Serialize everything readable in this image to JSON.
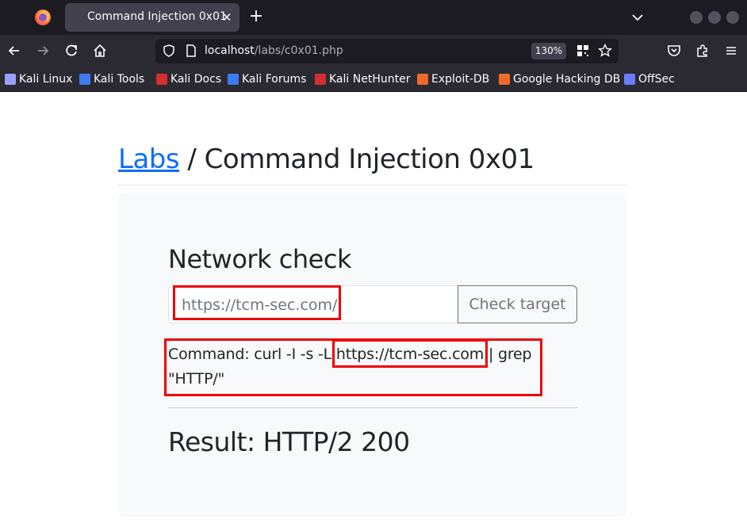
{
  "browser": {
    "tab_title": "Command Injection 0x01",
    "tab_close": "✕",
    "new_tab": "+",
    "url_host": "localhost",
    "url_path": "/labs/c0x01.php",
    "zoom": "130%"
  },
  "bookmarks": [
    {
      "label": "Kali Linux",
      "icon": "kali-dragon-icon",
      "color": "#9aa0ff"
    },
    {
      "label": "Kali Tools",
      "icon": "kali-tools-icon",
      "color": "#3d7cf0"
    },
    {
      "label": "Kali Docs",
      "icon": "kali-docs-icon",
      "color": "#d32f2f"
    },
    {
      "label": "Kali Forums",
      "icon": "kali-forums-icon",
      "color": "#3d7cf0"
    },
    {
      "label": "Kali NetHunter",
      "icon": "nethunter-icon",
      "color": "#d32f2f"
    },
    {
      "label": "Exploit-DB",
      "icon": "exploit-db-icon",
      "color": "#f06a2a"
    },
    {
      "label": "Google Hacking DB",
      "icon": "ghdb-icon",
      "color": "#f06a2a"
    },
    {
      "label": "OffSec",
      "icon": "offsec-icon",
      "color": "#6b7cff"
    }
  ],
  "page": {
    "breadcrumb_link": "Labs",
    "breadcrumb_rest": " / Command Injection 0x01",
    "card_title": "Network check",
    "url_input_value": "https://tcm-sec.com/",
    "check_button": "Check target",
    "command_text": "Command: curl -I -s -L https://tcm-sec.com | grep \"HTTP/\"",
    "result_text": "Result: HTTP/2 200"
  },
  "colors": {
    "link": "#0d6efd",
    "annotation": "#ee0000",
    "chrome_dark": "#1c1b22",
    "chrome": "#2b2a33"
  }
}
